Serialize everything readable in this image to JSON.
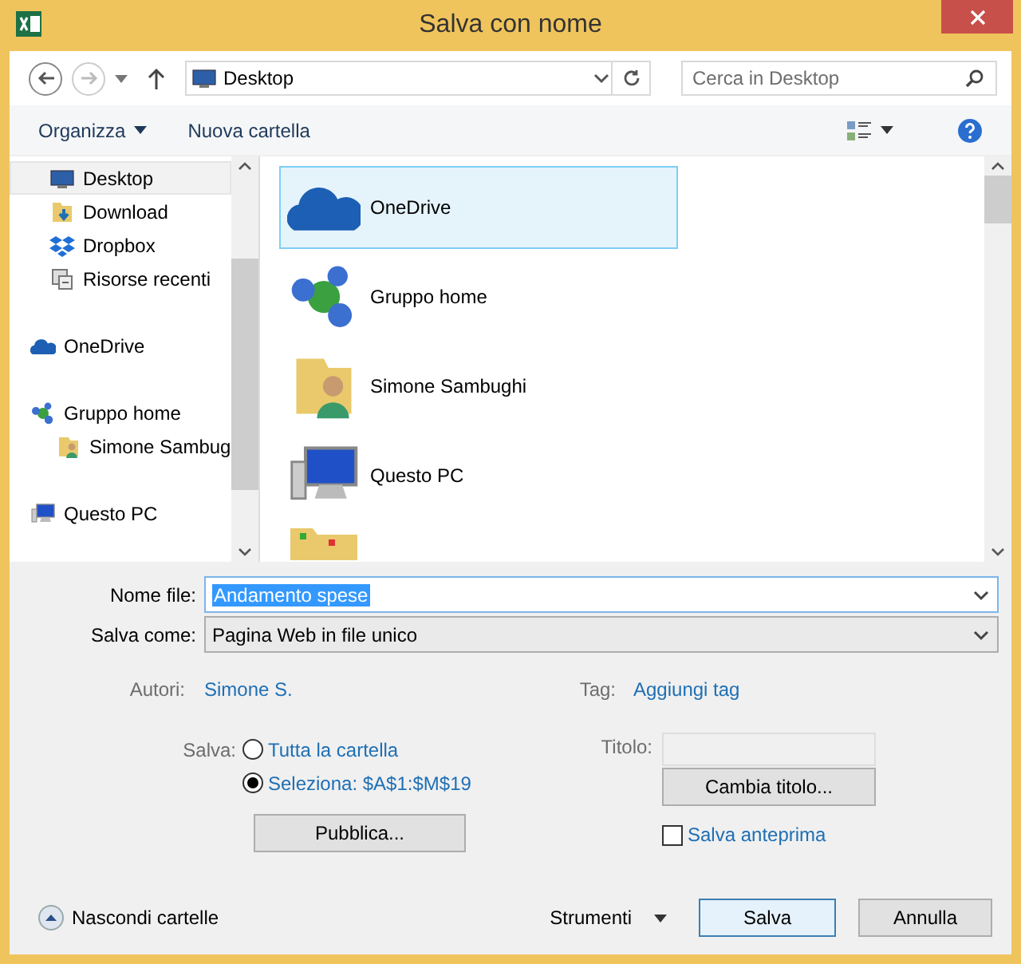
{
  "window": {
    "title": "Salva con nome"
  },
  "navigation": [
    {
      "kind": "back",
      "disabled": false
    },
    {
      "kind": "forward",
      "disabled": true
    }
  ],
  "address_bar": {
    "location": "Desktop"
  },
  "search": {
    "placeholder": "Cerca in Desktop"
  },
  "toolbar": {
    "organize": "Organizza",
    "new_folder": "Nuova cartella"
  },
  "nav_tree": [
    {
      "children": [
        {
          "label": "Desktop",
          "kind": "desktop",
          "selected": true
        },
        {
          "label": "Download",
          "kind": "download",
          "selected": false
        },
        {
          "label": "Dropbox",
          "kind": "dropbox",
          "selected": false
        },
        {
          "label": "Risorse recenti",
          "kind": "recent",
          "selected": false
        }
      ]
    },
    {
      "label": "OneDrive",
      "kind": "onedrive",
      "selected": false
    },
    {
      "label": "Gruppo home",
      "kind": "homegroup",
      "selected": false,
      "children": [
        {
          "label": "Simone Sambug",
          "kind": "user",
          "selected": false
        }
      ]
    },
    {
      "label": "Questo PC",
      "kind": "pc",
      "selected": false
    }
  ],
  "items": [
    {
      "label": "OneDrive",
      "kind": "onedrive",
      "selected": true
    },
    {
      "label": "Gruppo home",
      "kind": "homegroup",
      "selected": false
    },
    {
      "label": "Simone Sambughi",
      "kind": "user",
      "selected": false
    },
    {
      "label": "Questo PC",
      "kind": "pc",
      "selected": false
    },
    {
      "kind": "folder",
      "selected": false
    }
  ],
  "form": {
    "file_name_label": "Nome file:",
    "file_name": "Andamento spese",
    "save_as_label": "Salva come:",
    "save_as": "Pagina Web in file unico",
    "authors_label": "Autori:",
    "authors": "Simone S.",
    "tags_label": "Tag:",
    "tags": "Aggiungi tag",
    "save_label": "Salva:",
    "save_options": [
      {
        "label": "Tutta la cartella",
        "selected": false
      },
      {
        "label": "Seleziona: $A$1:$M$19",
        "selected": true
      }
    ],
    "publish": "Pubblica...",
    "title_label": "Titolo:",
    "change_title": "Cambia titolo...",
    "preview": {
      "label": "Salva anteprima",
      "checked": false
    }
  },
  "footer": {
    "hide_folders": "Nascondi cartelle",
    "tools": "Strumenti",
    "save": "Salva",
    "cancel": "Annulla"
  }
}
